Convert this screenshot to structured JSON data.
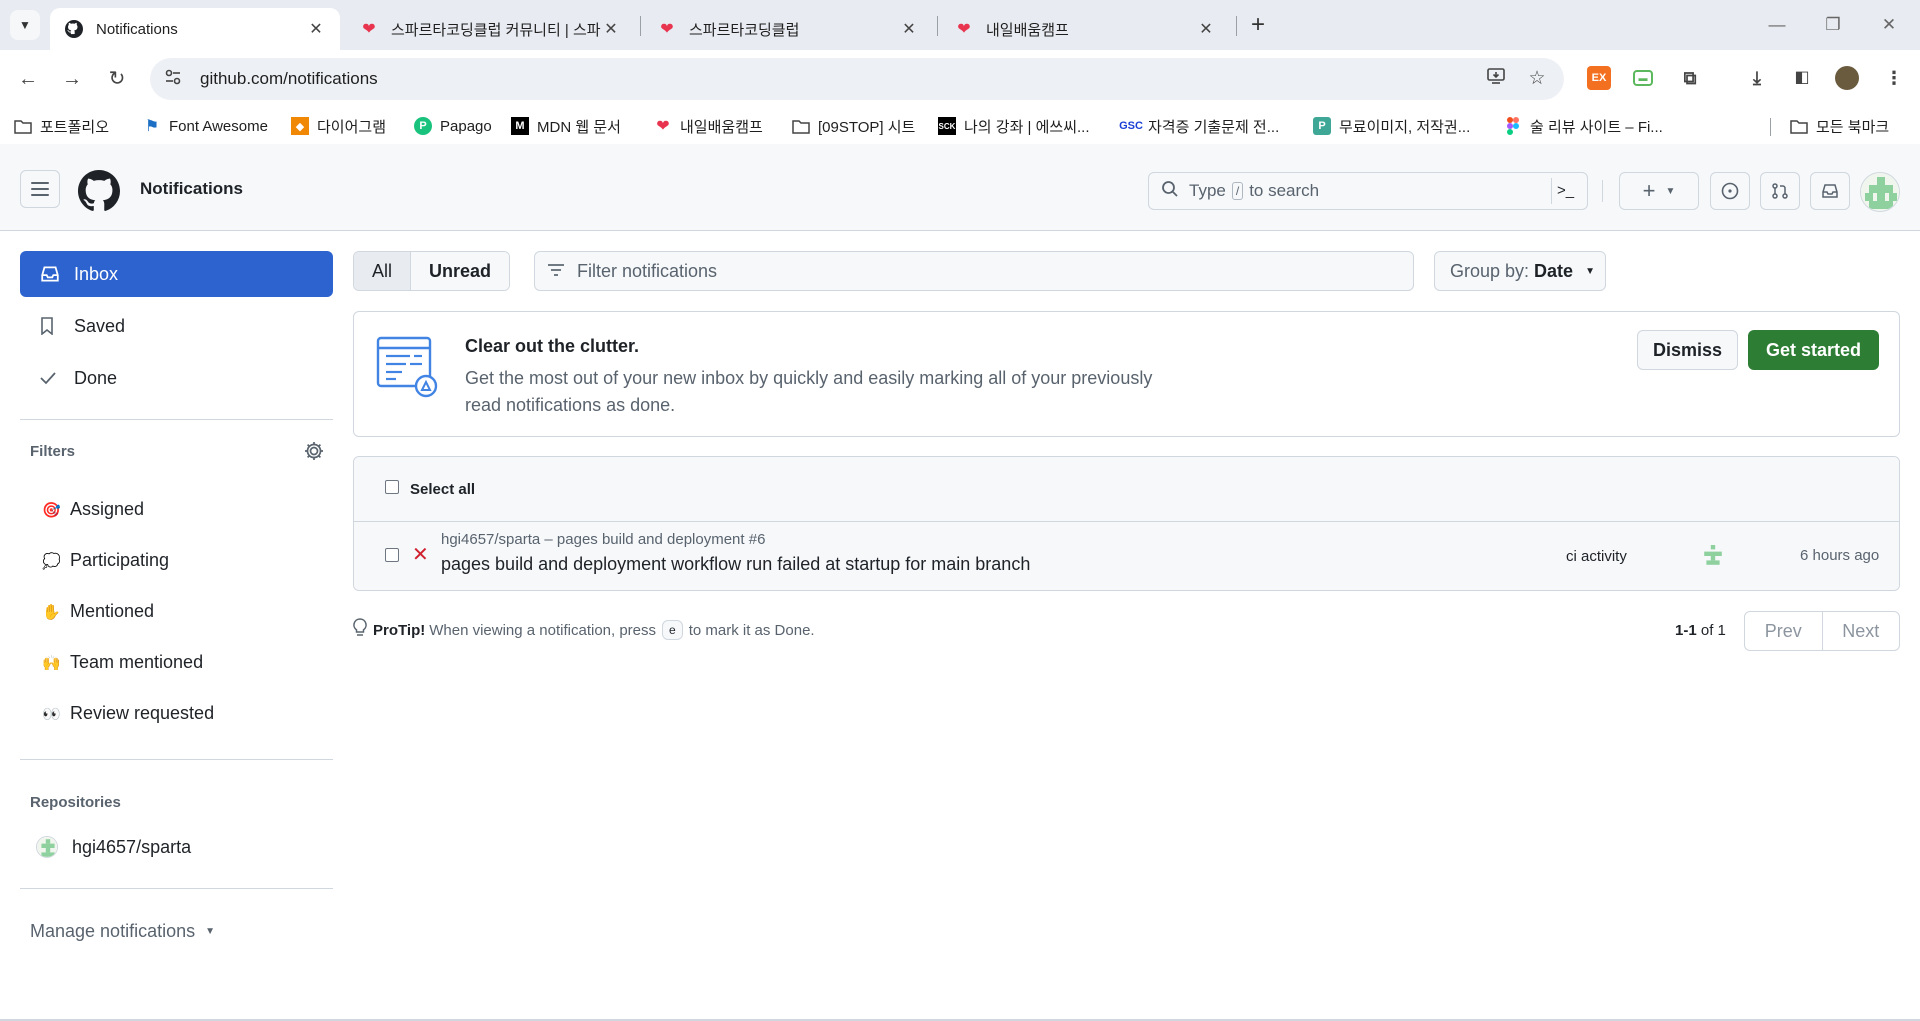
{
  "browser": {
    "tabs": [
      {
        "title": "Notifications",
        "active": true
      },
      {
        "title": "스파르타코딩클럽 커뮤니티 | 스파르타",
        "active": false
      },
      {
        "title": "스파르타코딩클럽",
        "active": false
      },
      {
        "title": "내일배움캠프",
        "active": false
      }
    ],
    "url": "github.com/notifications",
    "bookmarks": [
      {
        "label": "포트폴리오",
        "icon": "folder-icon"
      },
      {
        "label": "Font Awesome",
        "icon": "flag-icon"
      },
      {
        "label": "다이어그램",
        "icon": "diagram-icon"
      },
      {
        "label": "Papago",
        "icon": "papago-icon"
      },
      {
        "label": "MDN 웹 문서",
        "icon": "mdn-icon"
      },
      {
        "label": "내일배움캠프",
        "icon": "sparta-icon"
      },
      {
        "label": "[09STOP] 시트",
        "icon": "folder-icon"
      },
      {
        "label": "나의 강좌 | 에쓰씨...",
        "icon": "sck-icon"
      },
      {
        "label": "자격증 기출문제 전...",
        "icon": "gsc-icon"
      },
      {
        "label": "무료이미지, 저작권...",
        "icon": "image-icon"
      },
      {
        "label": "술 리뷰 사이트 – Fi...",
        "icon": "figma-icon"
      }
    ],
    "all_bookmarks": "모든 북마크"
  },
  "header": {
    "title": "Notifications",
    "search_prefix": "Type",
    "search_key": "/",
    "search_suffix": "to search"
  },
  "sidebar": {
    "items": [
      {
        "label": "Inbox",
        "icon": "inbox-icon"
      },
      {
        "label": "Saved",
        "icon": "bookmark-icon"
      },
      {
        "label": "Done",
        "icon": "check-icon"
      }
    ],
    "filters_heading": "Filters",
    "filters": [
      {
        "label": "Assigned",
        "emoji": "🎯"
      },
      {
        "label": "Participating",
        "emoji": "💭"
      },
      {
        "label": "Mentioned",
        "emoji": "✋"
      },
      {
        "label": "Team mentioned",
        "emoji": "🙌"
      },
      {
        "label": "Review requested",
        "emoji": "👀"
      }
    ],
    "repos_heading": "Repositories",
    "repos": [
      {
        "label": "hgi4657/sparta"
      }
    ],
    "manage": "Manage notifications"
  },
  "main": {
    "tab_all": "All",
    "tab_unread": "Unread",
    "filter_placeholder": "Filter notifications",
    "group_label": "Group by:",
    "group_value": "Date",
    "banner": {
      "title": "Clear out the clutter.",
      "body": "Get the most out of your new inbox by quickly and easily marking all of your previously read notifications as done.",
      "dismiss": "Dismiss",
      "start": "Get started"
    },
    "select_all": "Select all",
    "notifications": [
      {
        "repo": "hgi4657/sparta – pages build and deployment #6",
        "message": "pages build and deployment workflow run failed at startup for main branch",
        "reason": "ci activity",
        "time": "6 hours ago"
      }
    ],
    "protip_label": "ProTip!",
    "protip_pre": "When viewing a notification, press",
    "protip_key": "e",
    "protip_post": "to mark it as Done.",
    "page_range": "1-1",
    "page_of": "of 1",
    "prev": "Prev",
    "next": "Next"
  },
  "colors": {
    "accent_blue": "#2d63cf",
    "start_green": "#2e7d34",
    "fail_red": "#cf222e"
  }
}
